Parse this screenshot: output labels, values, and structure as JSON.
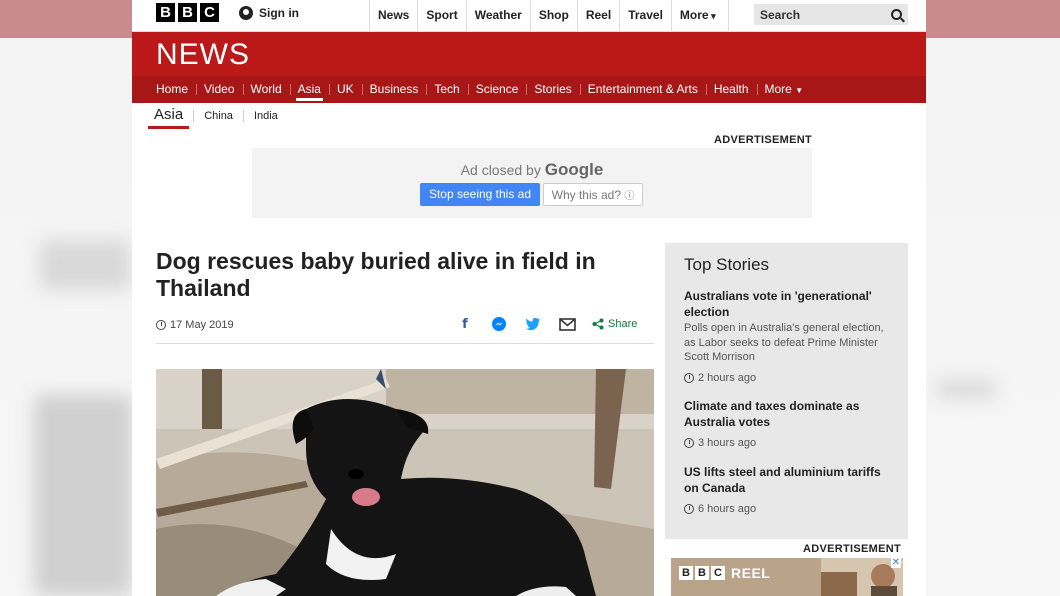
{
  "topbar": {
    "logo_letters": [
      "B",
      "B",
      "C"
    ],
    "signin_label": "Sign in",
    "nav": [
      "News",
      "Sport",
      "Weather",
      "Shop",
      "Reel",
      "Travel",
      "More"
    ],
    "search_placeholder": "Search"
  },
  "header": {
    "title": "NEWS",
    "sections": [
      "Home",
      "Video",
      "World",
      "Asia",
      "UK",
      "Business",
      "Tech",
      "Science",
      "Stories",
      "Entertainment & Arts",
      "Health",
      "More"
    ],
    "active_section": "Asia"
  },
  "subnav": {
    "current": "Asia",
    "links": [
      "China",
      "India"
    ]
  },
  "ads": {
    "label_top": "ADVERTISEMENT",
    "closed_prefix": "Ad closed by",
    "closed_brand": "Google",
    "stop_button": "Stop seeing this ad",
    "why_button": "Why this ad?",
    "label_side": "ADVERTISEMENT",
    "reel_word": "REEL"
  },
  "article": {
    "headline": "Dog rescues baby buried alive in field in Thailand",
    "date": "17 May 2019",
    "share_label": "Share"
  },
  "top_stories": {
    "heading": "Top Stories",
    "items": [
      {
        "title": "Australians vote in 'generational' election",
        "summary": "Polls open in Australia's general election, as Labor seeks to defeat Prime Minister Scott Morrison",
        "time": "2 hours ago"
      },
      {
        "title": "Climate and taxes dominate as Australia votes",
        "summary": "",
        "time": "3 hours ago"
      },
      {
        "title": "US lifts steel and aluminium tariffs on Canada",
        "summary": "",
        "time": "6 hours ago"
      }
    ]
  },
  "colors": {
    "news_red": "#bb1919",
    "section_red": "#a71717",
    "google_blue": "#4285f4",
    "share_green": "#0b7d3e"
  }
}
